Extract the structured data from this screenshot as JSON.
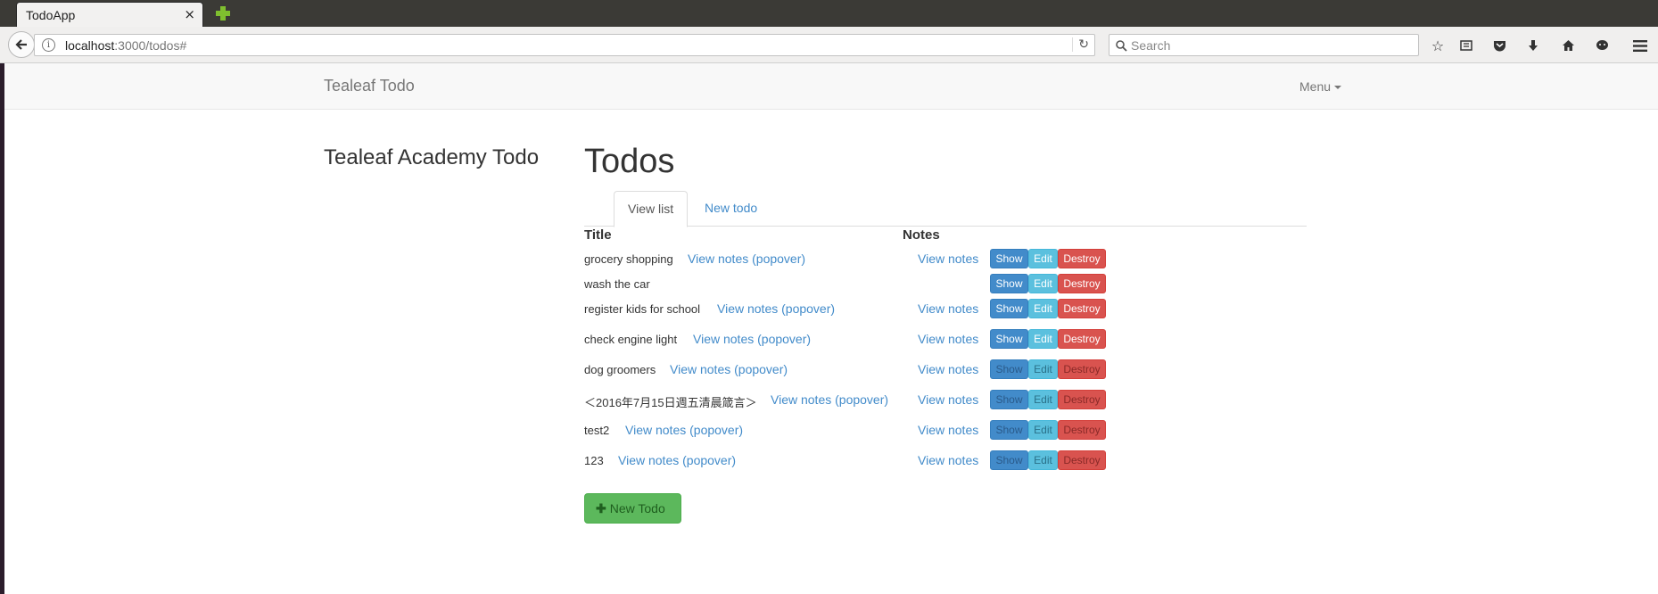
{
  "browser": {
    "tab_title": "TodoApp",
    "tab_close": "×",
    "url_host": "localhost",
    "url_rest": ":3000/todos#",
    "search_placeholder": "Search"
  },
  "navbar": {
    "brand": "Tealeaf Todo",
    "menu_label": "Menu"
  },
  "sidebar_title": "Tealeaf Academy Todo",
  "page_title": "Todos",
  "tabs": [
    {
      "label": "View list",
      "active": true
    },
    {
      "label": "New todo",
      "active": false
    }
  ],
  "table": {
    "headers": {
      "title": "Title",
      "notes": "Notes"
    },
    "actions": {
      "show": "Show",
      "edit": "Edit",
      "destroy": "Destroy"
    },
    "rows": [
      {
        "title": "grocery shopping",
        "popover": "View notes (popover)",
        "notes": "View notes"
      },
      {
        "title": "wash the car",
        "popover": "",
        "notes": ""
      },
      {
        "title": "register kids for school",
        "popover": "View notes (popover)",
        "notes": "View notes"
      },
      {
        "title": "check engine light",
        "popover": "View notes (popover)",
        "notes": "View notes"
      },
      {
        "title": "dog groomers",
        "popover": "View notes (popover)",
        "notes": "View notes"
      },
      {
        "title": "＜2016年7月15日週五清晨箴言＞",
        "popover": "View notes (popover)",
        "notes": "View notes"
      },
      {
        "title": "test2",
        "popover": "View notes (popover)",
        "notes": "View notes"
      },
      {
        "title": "123",
        "popover": "View notes (popover)",
        "notes": "View notes"
      }
    ]
  },
  "new_todo_button": "New Todo",
  "colors": {
    "link": "#428bca",
    "show": "#428bca",
    "edit": "#5bc0de",
    "destroy": "#d9534f",
    "success": "#5cb85c"
  }
}
